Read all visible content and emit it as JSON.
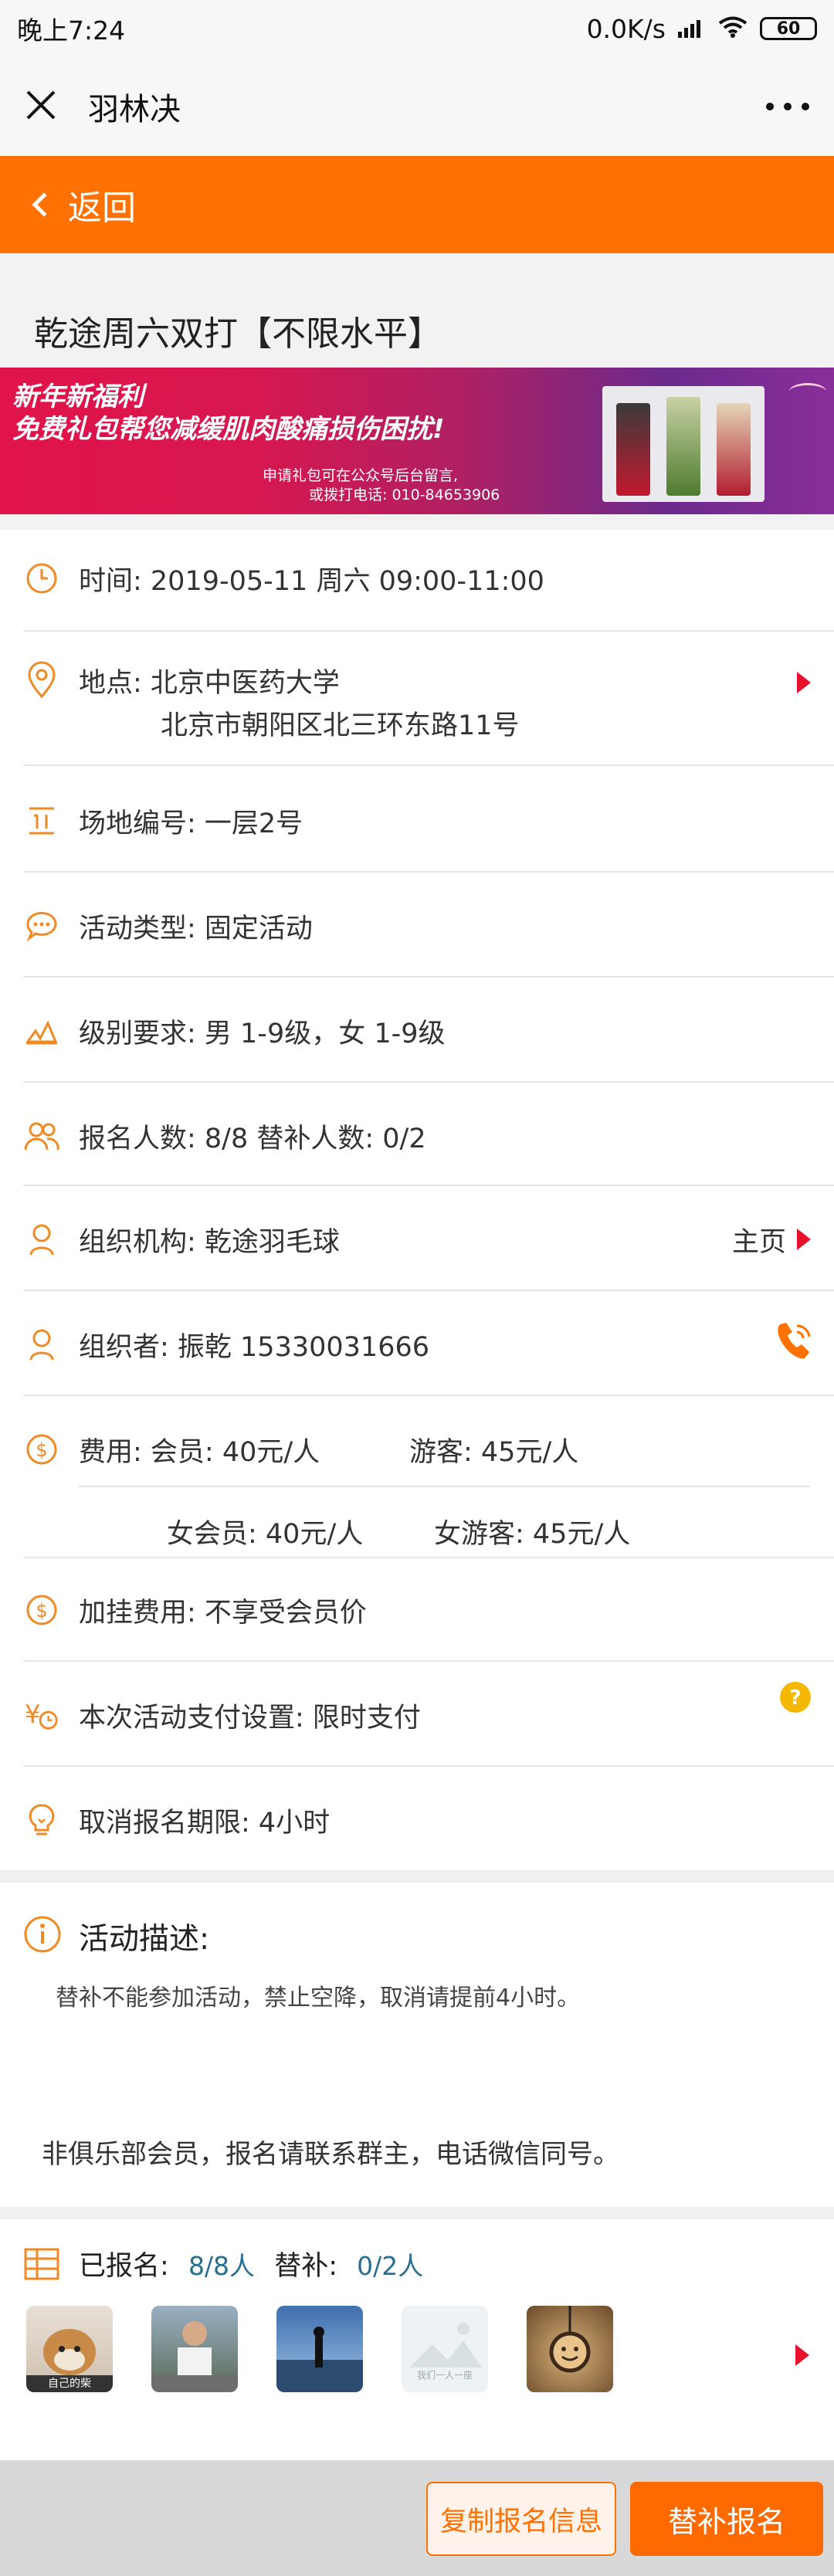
{
  "status": {
    "time": "晚上7:24",
    "speed": "0.0K/s",
    "battery": "60"
  },
  "nav": {
    "title": "羽林决"
  },
  "back": {
    "label": "返回"
  },
  "activity": {
    "title": "乾途周六双打【不限水平】"
  },
  "banner": {
    "line1": "新年新福利",
    "line2": "免费礼包帮您减缓肌肉酸痛损伤困扰!",
    "line3": "申请礼包可在公众号后台留言,",
    "line4": "或拨打电话: 010-84653906"
  },
  "info": {
    "time": "时间: 2019-05-11 周六 09:00-11:00",
    "location_line1": "地点: 北京中医药大学",
    "location_line2": "北京市朝阳区北三环东路11号",
    "court": "场地编号: 一层2号",
    "type": "活动类型: 固定活动",
    "level": "级别要求: 男 1-9级，女 1-9级",
    "count": "报名人数: 8/8   替补人数: 0/2",
    "org": "组织机构: 乾途羽毛球",
    "org_link": "主页",
    "organizer": "组织者: 振乾   15330031666",
    "fee_line1_a": "费用: 会员: 40元/人",
    "fee_line1_b": "游客: 45元/人",
    "fee_line2_a": "女会员: 40元/人",
    "fee_line2_b": "女游客: 45元/人",
    "extra_fee": "加挂费用: 不享受会员价",
    "payment": "本次活动支付设置: 限时支付",
    "cancel": "取消报名期限: 4小时"
  },
  "description": {
    "title": "活动描述:",
    "text1": "替补不能参加活动，禁止空降，取消请提前4小时。",
    "text2": "非俱乐部会员，报名请联系群主，电话微信同号。"
  },
  "signup": {
    "label_signed": "已报名:",
    "signed": "8/8人",
    "label_sub": "替补:",
    "sub": "0/2人",
    "avatar_caption_1": "自己的柴",
    "avatar_caption_4": "我们一人一座"
  },
  "buttons": {
    "copy": "复制报名信息",
    "substitute": "替补报名"
  },
  "colors": {
    "accent": "#ff7102",
    "chevron_red": "#e8112d"
  }
}
